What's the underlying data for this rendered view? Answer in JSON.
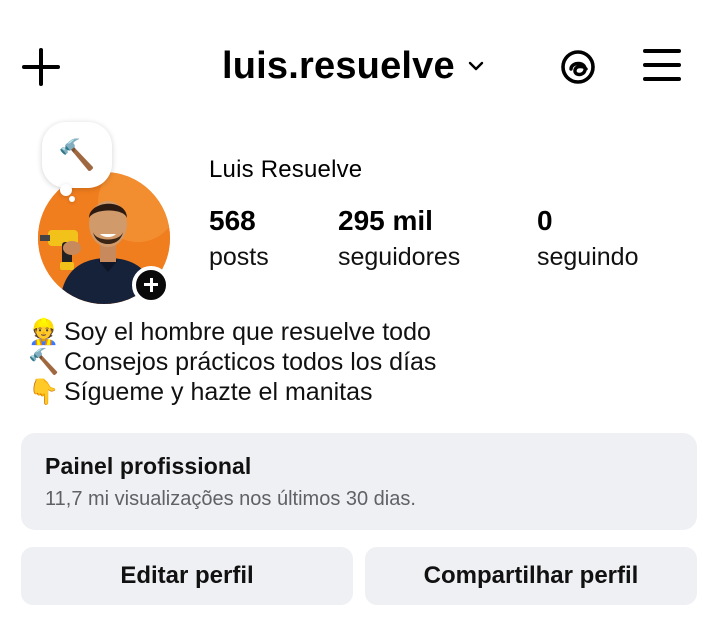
{
  "header": {
    "username": "luis.resuelve",
    "icons": [
      "plus-icon",
      "chevron-down-icon",
      "threads-icon",
      "menu-icon"
    ]
  },
  "profile": {
    "note_emoji": "🔨",
    "display_name": "Luis Resuelve",
    "stats": [
      {
        "value": "568",
        "label": "posts"
      },
      {
        "value": "295 mil",
        "label": "seguidores"
      },
      {
        "value": "0",
        "label": "seguindo"
      }
    ],
    "bio": [
      {
        "emoji": "👷",
        "text": "Soy el hombre que resuelve todo"
      },
      {
        "emoji": "🔨",
        "text": "Consejos prácticos todos los días"
      },
      {
        "emoji": "👇",
        "text": "Sígueme y hazte el manitas"
      }
    ]
  },
  "dashboard": {
    "title": "Painel profissional",
    "subtitle": "11,7 mi visualizações nos últimos 30 dias."
  },
  "actions": {
    "edit_label": "Editar perfil",
    "share_label": "Compartilhar perfil"
  },
  "colors": {
    "avatar_bg": "#f27a1a",
    "card_bg": "#eff0f3",
    "muted_text": "#5e6166"
  }
}
